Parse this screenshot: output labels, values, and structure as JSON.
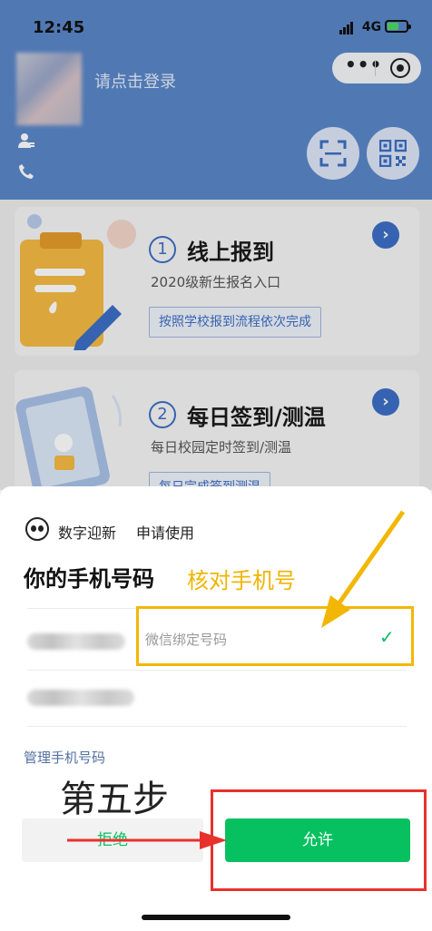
{
  "status_bar": {
    "time": "12:45",
    "network": "4G"
  },
  "header": {
    "login_prompt": "请点击登录"
  },
  "cards": [
    {
      "number": "1",
      "title": "线上报到",
      "subtitle": "2020级新生报名入口",
      "tag": "按照学校报到流程依次完成"
    },
    {
      "number": "2",
      "title": "每日签到/测温",
      "subtitle": "每日校园定时签到/测温",
      "tag": "每日完成签到测温"
    }
  ],
  "sheet": {
    "app_name": "数字迎新",
    "request": "申请使用",
    "title": "你的手机号码",
    "phone_option_label": "微信绑定号码",
    "manage_link": "管理手机号码",
    "reject_label": "拒绝",
    "allow_label": "允许"
  },
  "annotations": {
    "check_phone": "核对手机号",
    "step": "第五步",
    "highlight_color": "#f2b705",
    "red_color": "#e8312d"
  },
  "colors": {
    "accent_blue": "#3d6fc6",
    "wechat_green": "#07c160",
    "header_blue": "#5a87c9"
  },
  "icons": [
    "user-icon",
    "phone-icon",
    "more-icon",
    "target-icon",
    "scan-icon",
    "qr-code-icon",
    "chevron-right-icon",
    "checkmark-icon",
    "panda-logo-icon"
  ]
}
